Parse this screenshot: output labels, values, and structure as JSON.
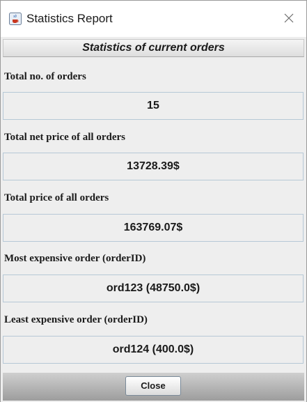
{
  "window": {
    "title": "Statistics Report",
    "app_icon": "java-coffee-cup-icon",
    "close_icon": "close-x-icon"
  },
  "header": {
    "title": "Statistics of current orders"
  },
  "stats": [
    {
      "label": "Total no. of orders",
      "value": "15"
    },
    {
      "label": "Total net price of all orders",
      "value": "13728.39$"
    },
    {
      "label": "Total price of all orders",
      "value": "163769.07$"
    },
    {
      "label": "Most expensive order (orderID)",
      "value": "ord123 (48750.0$)"
    },
    {
      "label": "Least expensive order (orderID)",
      "value": "ord124 (400.0$)"
    }
  ],
  "footer": {
    "close_label": "Close"
  },
  "colors": {
    "panel_bg": "#eeeeee",
    "field_border": "#b6c8d6",
    "button_border": "#7a8a99"
  }
}
